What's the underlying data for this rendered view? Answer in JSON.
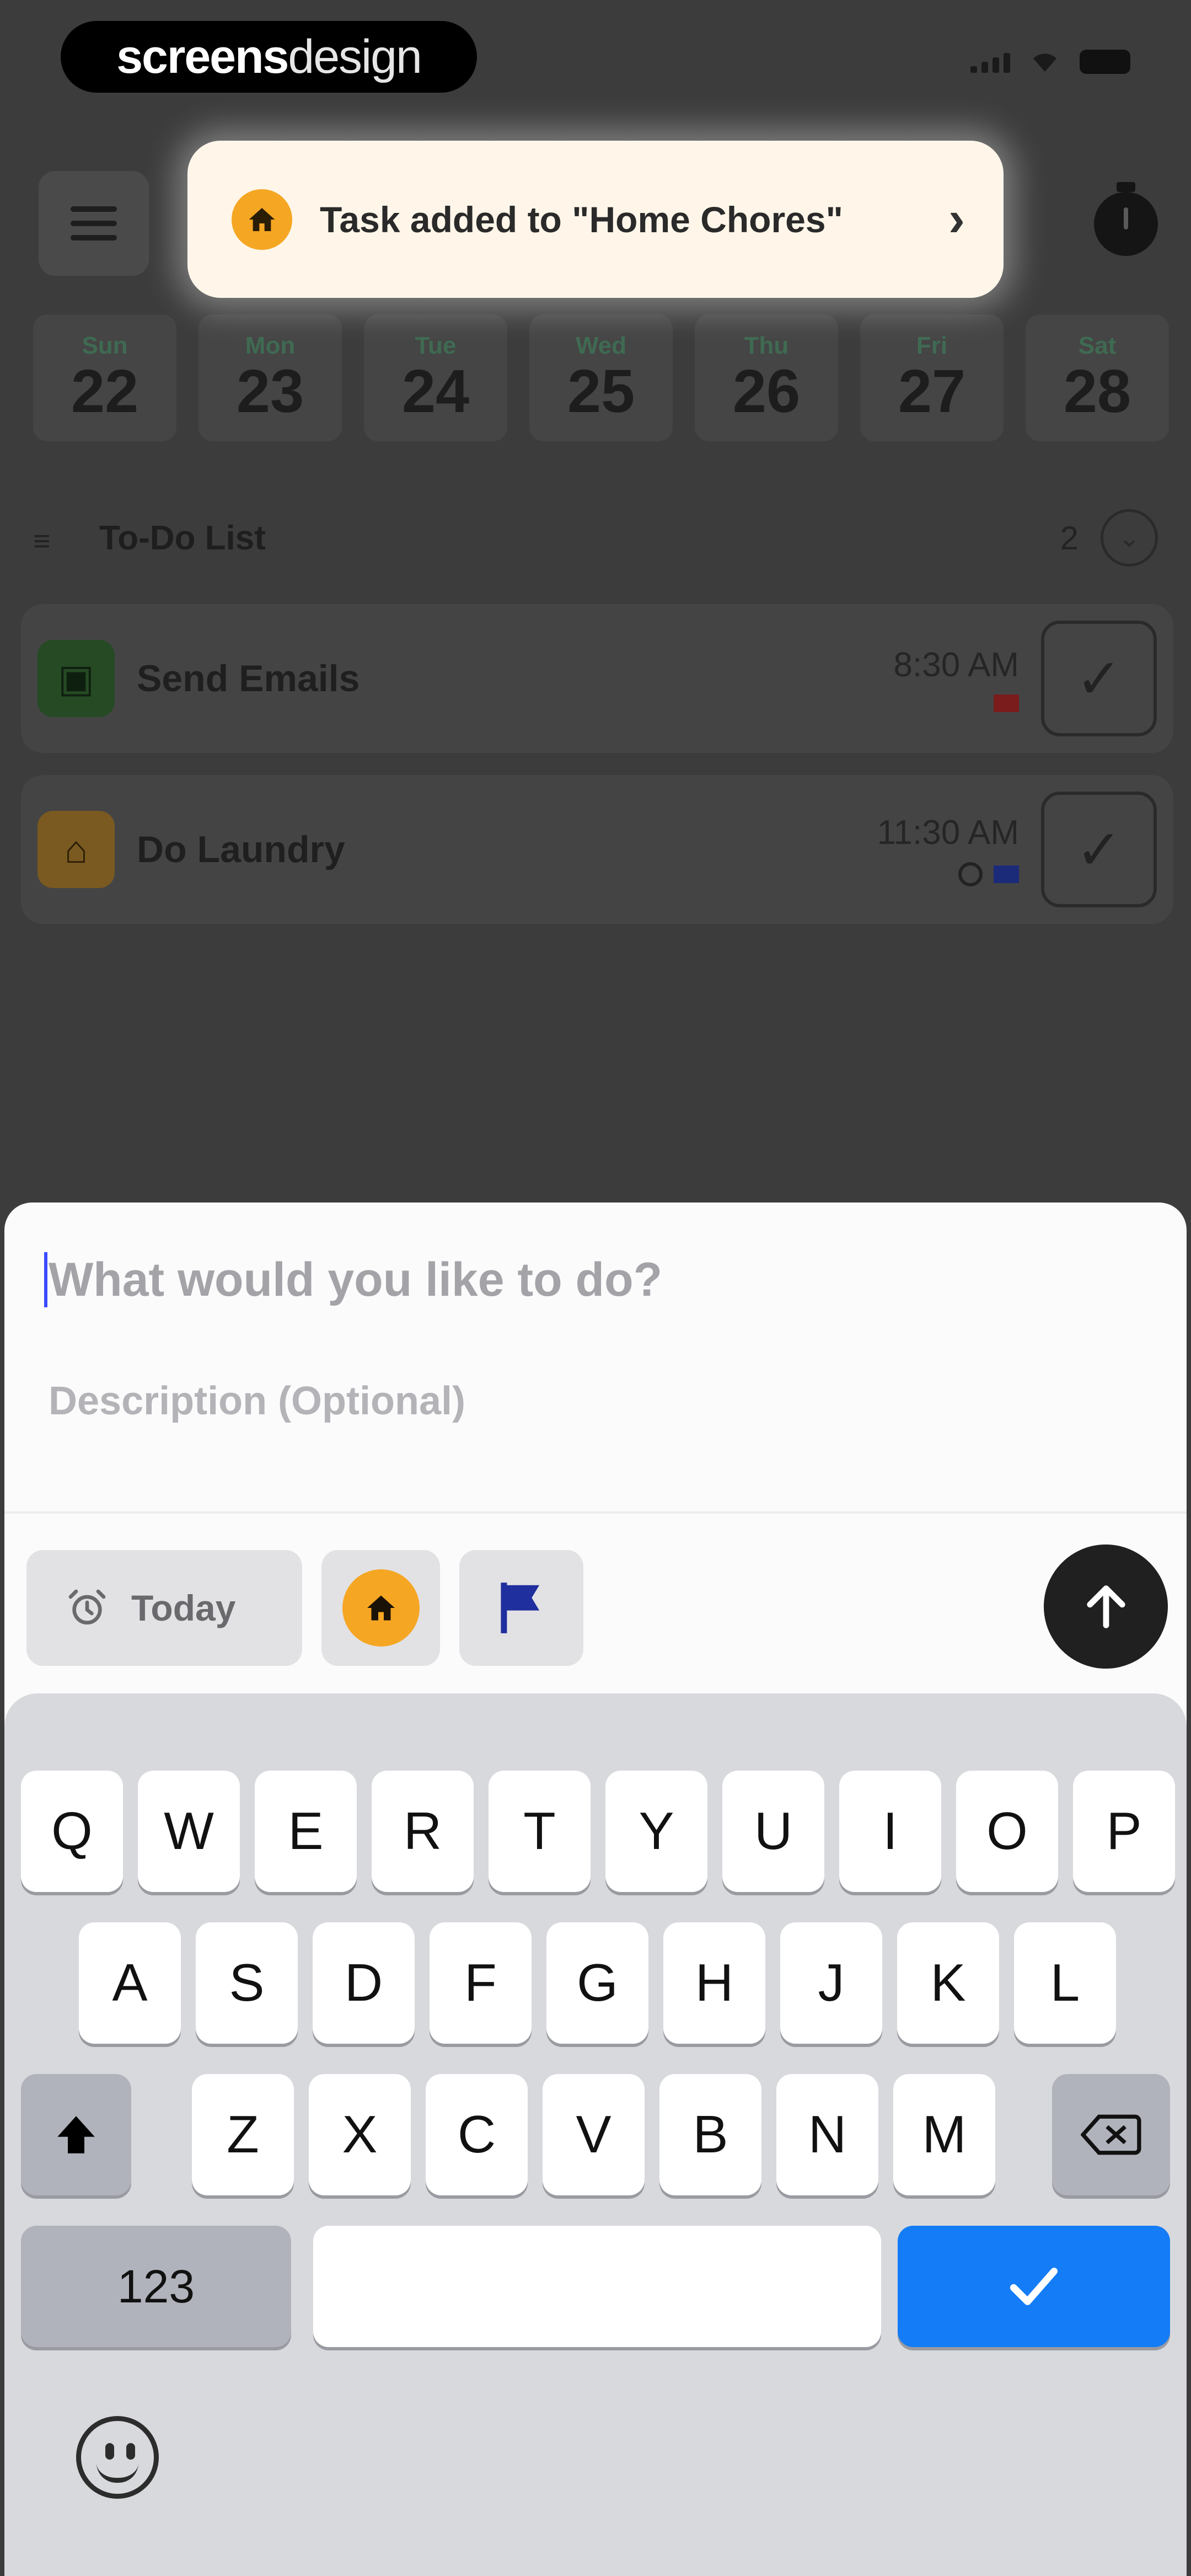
{
  "status_bar": {
    "watermark_bold": "screens",
    "watermark_light": "design"
  },
  "header": {
    "menu_icon": "hamburger-menu-icon",
    "timer_icon": "stopwatch-icon"
  },
  "week": {
    "days": [
      {
        "name": "Sun",
        "num": "22"
      },
      {
        "name": "Mon",
        "num": "23"
      },
      {
        "name": "Tue",
        "num": "24"
      },
      {
        "name": "Wed",
        "num": "25"
      },
      {
        "name": "Thu",
        "num": "26"
      },
      {
        "name": "Fri",
        "num": "27"
      },
      {
        "name": "Sat",
        "num": "28"
      }
    ]
  },
  "todo": {
    "title": "To-Do List",
    "count": "2",
    "tasks": [
      {
        "name": "Send Emails",
        "time": "8:30 AM",
        "icon": "briefcase-icon",
        "flag_color": "#7a1c1c"
      },
      {
        "name": "Do Laundry",
        "time": "11:30 AM",
        "icon": "home-icon",
        "flag_color": "#1c2a7a"
      }
    ]
  },
  "toast": {
    "text": "Task added to \"Home Chores\"",
    "icon": "home-icon",
    "accent": "#f5a623"
  },
  "composer": {
    "title_placeholder": "What would you like to do?",
    "description_placeholder": "Description (Optional)",
    "date_chip": "Today",
    "category_color": "#f5a623",
    "flag_color": "#1f2f9e"
  },
  "keyboard": {
    "row1": [
      "Q",
      "W",
      "E",
      "R",
      "T",
      "Y",
      "U",
      "I",
      "O",
      "P"
    ],
    "row2": [
      "A",
      "S",
      "D",
      "F",
      "G",
      "H",
      "J",
      "K",
      "L"
    ],
    "row3": [
      "Z",
      "X",
      "C",
      "V",
      "B",
      "N",
      "M"
    ],
    "numbers_key": "123",
    "return_icon": "checkmark-icon",
    "accent": "#137cf6"
  }
}
